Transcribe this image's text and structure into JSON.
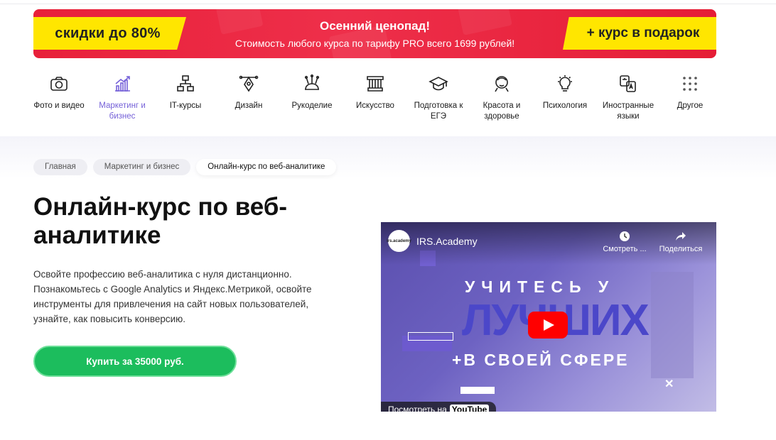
{
  "banner": {
    "left_tag": "скидки до 80%",
    "title": "Осенний ценопад!",
    "subtitle": "Стоимость любого курса по тарифу PRO всего 1699 рублей!",
    "right_tag": "+ курс в подарок"
  },
  "categories": [
    {
      "label": "Фото и видео",
      "icon": "camera-icon"
    },
    {
      "label": "Маркетинг и бизнес",
      "icon": "chart-icon",
      "active": true
    },
    {
      "label": "IT-курсы",
      "icon": "network-icon"
    },
    {
      "label": "Дизайн",
      "icon": "pen-tool-icon"
    },
    {
      "label": "Рукоделие",
      "icon": "pincushion-icon"
    },
    {
      "label": "Искусство",
      "icon": "column-icon"
    },
    {
      "label": "Подготовка к ЕГЭ",
      "icon": "graduation-cap-icon"
    },
    {
      "label": "Красота и здоровье",
      "icon": "face-icon"
    },
    {
      "label": "Психология",
      "icon": "lightbulb-icon"
    },
    {
      "label": "Иностранные языки",
      "icon": "translate-icon"
    },
    {
      "label": "Другое",
      "icon": "dots-grid-icon"
    }
  ],
  "breadcrumbs": [
    "Главная",
    "Маркетинг и бизнес",
    "Онлайн-курс по веб-аналитике"
  ],
  "page": {
    "title": "Онлайн-курс по веб-аналитике",
    "description": "Освойте профессию веб-аналитика с нуля дистанционно. Познакомьтесь с Google Analytics и Яндекс.Метрикой, освойте инструменты для привлечения на сайт новых пользователей, узнайте, как повысить конверсию.",
    "buy_label": "Купить за 35000 руб."
  },
  "video": {
    "channel": "IRS.Academy",
    "avatar_text": "irs.academy",
    "watch_later": "Смотреть ...",
    "share": "Поделиться",
    "line1": "УЧИТЕСЬ У",
    "line2": "ЛУЧШИХ",
    "line3": "+В СВОЕЙ СФЕРЕ",
    "watch_on": "Посмотреть на",
    "youtube": "YouTube"
  },
  "colors": {
    "accent": "#7561d8",
    "buy": "#1cbd5d",
    "banner_red": "#e8203a",
    "banner_yellow": "#ffe600"
  }
}
